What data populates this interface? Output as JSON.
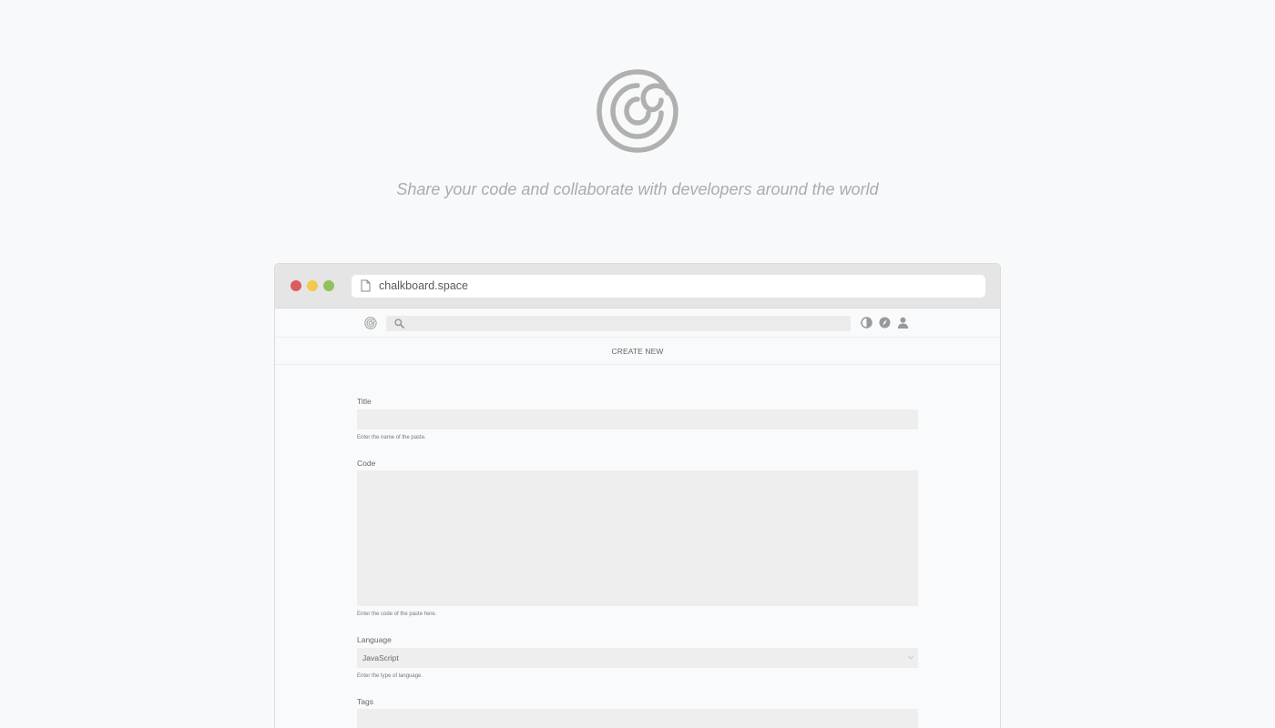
{
  "hero": {
    "tagline": "Share your code and collaborate with developers around the world"
  },
  "browser": {
    "url": "chalkboard.space"
  },
  "navbar": {
    "search_placeholder": ""
  },
  "subbar": {
    "create_new_label": "CREATE NEW"
  },
  "form": {
    "title": {
      "label": "Title",
      "value": "",
      "help": "Enter the name of the paste."
    },
    "code": {
      "label": "Code",
      "value": "",
      "help": "Enter the code of the paste here."
    },
    "language": {
      "label": "Language",
      "selected": "JavaScript",
      "help": "Enter the type of language."
    },
    "tags": {
      "label": "Tags",
      "value": ""
    }
  },
  "colors": {
    "background": "#f8f9fa",
    "logo_gray": "#b0b0b0",
    "traffic_red": "#dd5b5b",
    "traffic_yellow": "#f2c94c",
    "traffic_green": "#8fc15d",
    "input_bg": "#eeeeee"
  },
  "icons": [
    "chalkboard-logo-icon",
    "page-icon",
    "search-icon",
    "contrast-icon",
    "compass-icon",
    "user-icon",
    "chevron-down-icon"
  ]
}
